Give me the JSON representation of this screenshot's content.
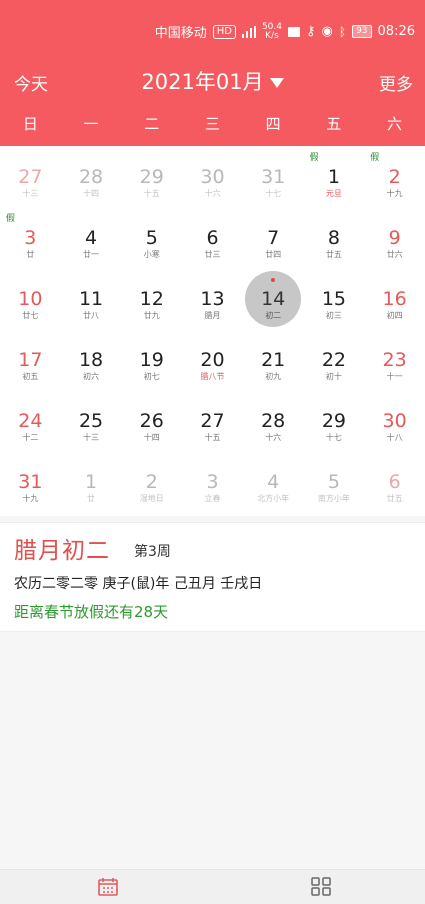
{
  "status_bar": {
    "carrier": "中国移动",
    "hd": "HD",
    "speed_value": "50.4",
    "speed_unit": "K/s",
    "battery": "93",
    "time": "08:26"
  },
  "header": {
    "today_label": "今天",
    "month_label": "2021年01月",
    "more_label": "更多"
  },
  "weekdays": [
    "日",
    "一",
    "二",
    "三",
    "四",
    "五",
    "六"
  ],
  "calendar": {
    "selected_day": "14",
    "days": [
      {
        "num": "27",
        "lunar": "十三",
        "other": true,
        "weekend": true
      },
      {
        "num": "28",
        "lunar": "十四",
        "other": true
      },
      {
        "num": "29",
        "lunar": "十五",
        "other": true
      },
      {
        "num": "30",
        "lunar": "十六",
        "other": true
      },
      {
        "num": "31",
        "lunar": "十七",
        "other": true
      },
      {
        "num": "1",
        "lunar": "元旦",
        "tag": "假",
        "lunar_red": true
      },
      {
        "num": "2",
        "lunar": "十九",
        "tag": "假",
        "weekend": true
      },
      {
        "num": "3",
        "lunar": "廿",
        "tag": "假",
        "weekend": true
      },
      {
        "num": "4",
        "lunar": "廿一"
      },
      {
        "num": "5",
        "lunar": "小寒"
      },
      {
        "num": "6",
        "lunar": "廿三"
      },
      {
        "num": "7",
        "lunar": "廿四"
      },
      {
        "num": "8",
        "lunar": "廿五"
      },
      {
        "num": "9",
        "lunar": "廿六",
        "weekend": true
      },
      {
        "num": "10",
        "lunar": "廿七",
        "weekend": true
      },
      {
        "num": "11",
        "lunar": "廿八"
      },
      {
        "num": "12",
        "lunar": "廿九"
      },
      {
        "num": "13",
        "lunar": "腊月"
      },
      {
        "num": "14",
        "lunar": "初二",
        "selected": true
      },
      {
        "num": "15",
        "lunar": "初三"
      },
      {
        "num": "16",
        "lunar": "初四",
        "weekend": true
      },
      {
        "num": "17",
        "lunar": "初五",
        "weekend": true
      },
      {
        "num": "18",
        "lunar": "初六"
      },
      {
        "num": "19",
        "lunar": "初七"
      },
      {
        "num": "20",
        "lunar": "腊八节",
        "lunar_red": true
      },
      {
        "num": "21",
        "lunar": "初九"
      },
      {
        "num": "22",
        "lunar": "初十"
      },
      {
        "num": "23",
        "lunar": "十一",
        "weekend": true
      },
      {
        "num": "24",
        "lunar": "十二",
        "weekend": true
      },
      {
        "num": "25",
        "lunar": "十三"
      },
      {
        "num": "26",
        "lunar": "十四"
      },
      {
        "num": "27",
        "lunar": "十五"
      },
      {
        "num": "28",
        "lunar": "十六"
      },
      {
        "num": "29",
        "lunar": "十七"
      },
      {
        "num": "30",
        "lunar": "十八",
        "weekend": true
      },
      {
        "num": "31",
        "lunar": "十九",
        "weekend": true
      },
      {
        "num": "1",
        "lunar": "廿",
        "other": true
      },
      {
        "num": "2",
        "lunar": "湿地日",
        "other": true
      },
      {
        "num": "3",
        "lunar": "立春",
        "other": true
      },
      {
        "num": "4",
        "lunar": "北方小年",
        "other": true
      },
      {
        "num": "5",
        "lunar": "南方小年",
        "other": true
      },
      {
        "num": "6",
        "lunar": "廿五",
        "other": true,
        "weekend": true
      }
    ]
  },
  "info": {
    "lunar_date": "腊月初二",
    "week": "第3周",
    "ganzhi": "农历二零二零 庚子(鼠)年 己丑月 壬戌日",
    "countdown": "距离春节放假还有28天"
  },
  "colors": {
    "accent": "#f45a5f",
    "holiday_green": "#2e8b2e",
    "lunar_red": "#e2504e"
  },
  "bottom_nav": {
    "tab1_icon": "calendar-icon",
    "tab2_icon": "grid-icon"
  }
}
